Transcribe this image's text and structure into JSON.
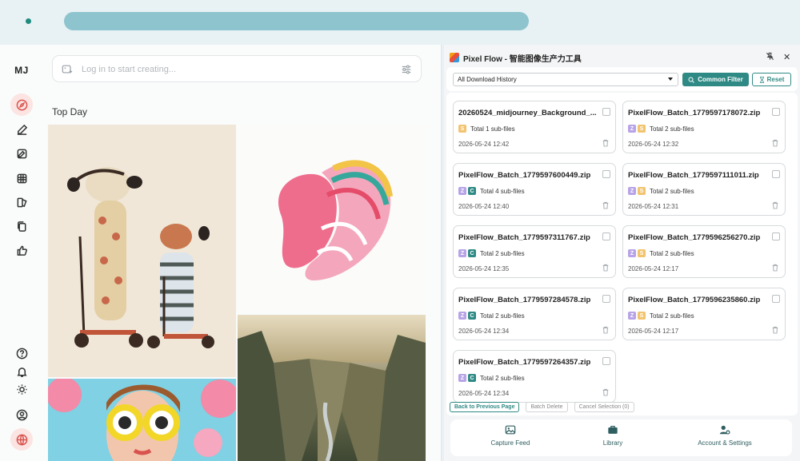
{
  "rail": {
    "logo": "MJ"
  },
  "search": {
    "placeholder": "Log in to start creating..."
  },
  "section_title": "Top Day",
  "panel": {
    "title": "Pixel Flow - 智能图像生产力工具",
    "select_value": "All Download History",
    "filter_label": "Common Filter",
    "reset_label": "Reset",
    "items": [
      {
        "name": "20260524_midjourney_Background_...",
        "tags": [
          "S"
        ],
        "total": "Total 1 sub-files",
        "date": "2026-05-24 12:42"
      },
      {
        "name": "PixelFlow_Batch_1779597178072.zip",
        "tags": [
          "Z",
          "S"
        ],
        "total": "Total 2 sub-files",
        "date": "2026-05-24 12:32"
      },
      {
        "name": "PixelFlow_Batch_1779597600449.zip",
        "tags": [
          "Z",
          "C"
        ],
        "total": "Total 4 sub-files",
        "date": "2026-05-24 12:40"
      },
      {
        "name": "PixelFlow_Batch_1779597111011.zip",
        "tags": [
          "Z",
          "S"
        ],
        "total": "Total 2 sub-files",
        "date": "2026-05-24 12:31"
      },
      {
        "name": "PixelFlow_Batch_1779597311767.zip",
        "tags": [
          "Z",
          "C"
        ],
        "total": "Total 2 sub-files",
        "date": "2026-05-24 12:35"
      },
      {
        "name": "PixelFlow_Batch_1779596256270.zip",
        "tags": [
          "Z",
          "S"
        ],
        "total": "Total 2 sub-files",
        "date": "2026-05-24 12:17"
      },
      {
        "name": "PixelFlow_Batch_1779597284578.zip",
        "tags": [
          "Z",
          "C"
        ],
        "total": "Total 2 sub-files",
        "date": "2026-05-24 12:34"
      },
      {
        "name": "PixelFlow_Batch_1779596235860.zip",
        "tags": [
          "Z",
          "S"
        ],
        "total": "Total 2 sub-files",
        "date": "2026-05-24 12:17"
      },
      {
        "name": "PixelFlow_Batch_1779597264357.zip",
        "tags": [
          "Z",
          "C"
        ],
        "total": "Total 2 sub-files",
        "date": "2026-05-24 12:34"
      }
    ],
    "actions": {
      "back": "Back to Previous Page",
      "batch_delete": "Batch Delete",
      "cancel": "Cancel Selection (0)"
    },
    "nav": {
      "capture": "Capture Feed",
      "library": "Library",
      "account": "Account & Settings"
    }
  },
  "colors": {
    "accent": "#2f8a85",
    "active_icon": "#d9534f",
    "urlbar": "#8ec4cd"
  }
}
